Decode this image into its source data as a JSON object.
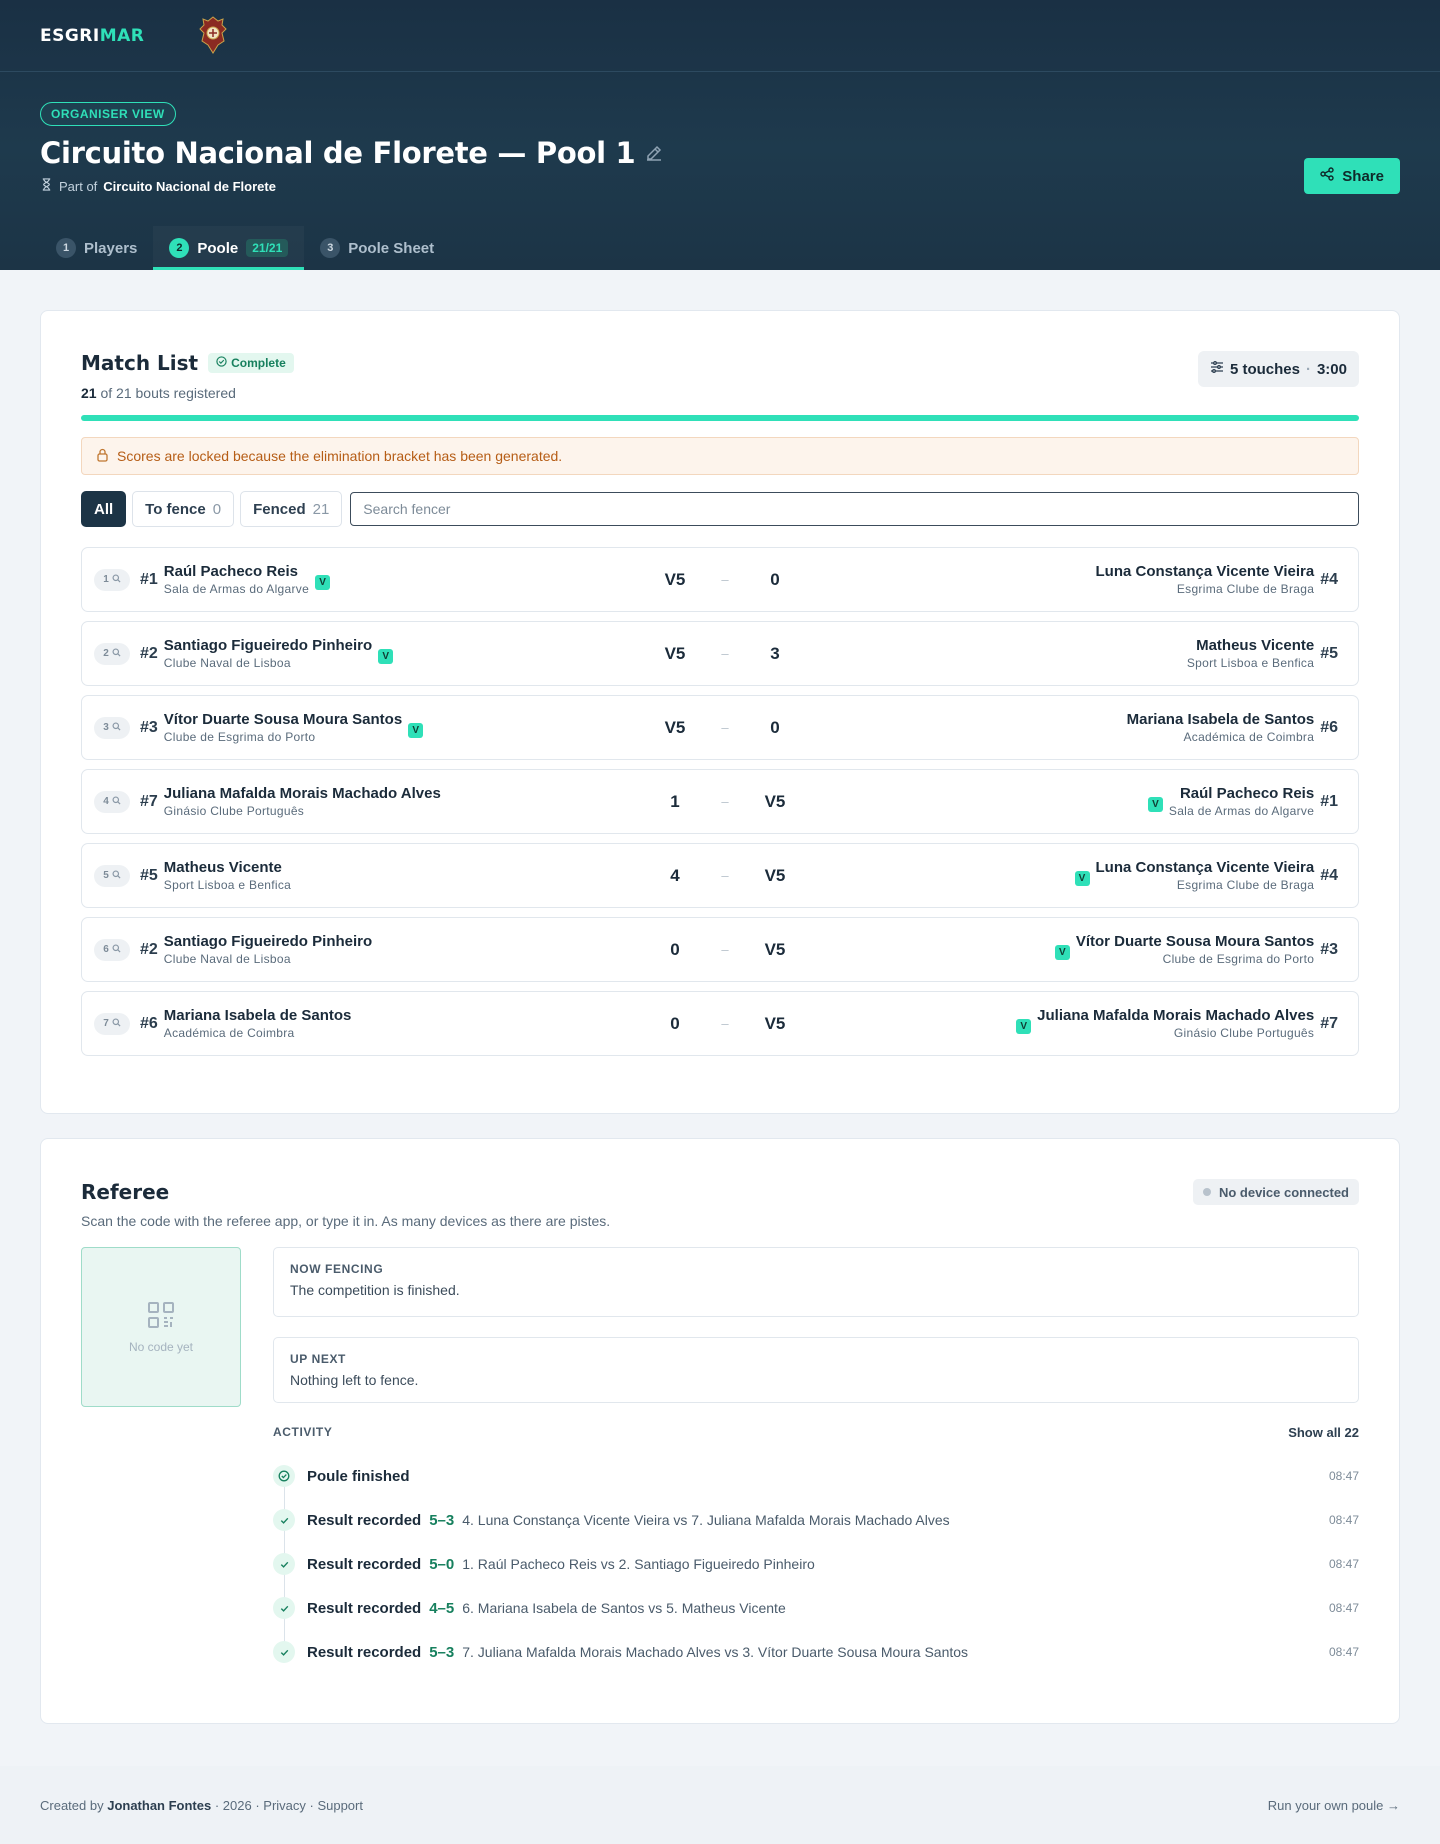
{
  "brand": {
    "logo_main": "ESGRI",
    "logo_accent": "MAR"
  },
  "header": {
    "badge": "ORGANISER VIEW",
    "title": "Circuito Nacional de Florete — Pool 1",
    "part_of_label": "Part of",
    "part_of_name": "Circuito Nacional de Florete",
    "share_label": "Share"
  },
  "tabs": [
    {
      "num": "1",
      "label": "Players"
    },
    {
      "num": "2",
      "label": "Poole",
      "count": "21/21"
    },
    {
      "num": "3",
      "label": "Poole Sheet"
    }
  ],
  "match_list": {
    "title": "Match List",
    "status": "Complete",
    "registered_count": "21",
    "registered_text": "of 21 bouts registered",
    "progress": 1.0,
    "touches": "5 touches",
    "time": "3:00",
    "locked_message": "Scores are locked because the elimination bracket has been generated.",
    "filters": {
      "all": "All",
      "to_fence": "To fence",
      "to_fence_count": "0",
      "fenced": "Fenced",
      "fenced_count": "21"
    },
    "search_placeholder": "Search fencer",
    "bouts": [
      {
        "n": "1",
        "left": {
          "seed": "#1",
          "name": "Raúl Pacheco Reis",
          "club": "Sala de Armas do Algarve",
          "winner": true
        },
        "left_score": "V5",
        "right_score": "0",
        "right": {
          "seed": "#4",
          "name": "Luna Constança Vicente Vieira",
          "club": "Esgrima Clube de Braga",
          "winner": false
        }
      },
      {
        "n": "2",
        "left": {
          "seed": "#2",
          "name": "Santiago Figueiredo Pinheiro",
          "club": "Clube Naval de Lisboa",
          "winner": true
        },
        "left_score": "V5",
        "right_score": "3",
        "right": {
          "seed": "#5",
          "name": "Matheus Vicente",
          "club": "Sport Lisboa e Benfica",
          "winner": false
        }
      },
      {
        "n": "3",
        "left": {
          "seed": "#3",
          "name": "Vítor Duarte Sousa Moura Santos",
          "club": "Clube de Esgrima do Porto",
          "winner": true
        },
        "left_score": "V5",
        "right_score": "0",
        "right": {
          "seed": "#6",
          "name": "Mariana Isabela de Santos",
          "club": "Académica de Coimbra",
          "winner": false
        }
      },
      {
        "n": "4",
        "left": {
          "seed": "#7",
          "name": "Juliana Mafalda Morais Machado Alves",
          "club": "Ginásio Clube Português",
          "winner": false
        },
        "left_score": "1",
        "right_score": "V5",
        "right": {
          "seed": "#1",
          "name": "Raúl Pacheco Reis",
          "club": "Sala de Armas do Algarve",
          "winner": true
        }
      },
      {
        "n": "5",
        "left": {
          "seed": "#5",
          "name": "Matheus Vicente",
          "club": "Sport Lisboa e Benfica",
          "winner": false
        },
        "left_score": "4",
        "right_score": "V5",
        "right": {
          "seed": "#4",
          "name": "Luna Constança Vicente Vieira",
          "club": "Esgrima Clube de Braga",
          "winner": true
        }
      },
      {
        "n": "6",
        "left": {
          "seed": "#2",
          "name": "Santiago Figueiredo Pinheiro",
          "club": "Clube Naval de Lisboa",
          "winner": false
        },
        "left_score": "0",
        "right_score": "V5",
        "right": {
          "seed": "#3",
          "name": "Vítor Duarte Sousa Moura Santos",
          "club": "Clube de Esgrima do Porto",
          "winner": true
        }
      },
      {
        "n": "7",
        "left": {
          "seed": "#6",
          "name": "Mariana Isabela de Santos",
          "club": "Académica de Coimbra",
          "winner": false
        },
        "left_score": "0",
        "right_score": "V5",
        "right": {
          "seed": "#7",
          "name": "Juliana Mafalda Morais Machado Alves",
          "club": "Ginásio Clube Português",
          "winner": true
        }
      }
    ],
    "winner_badge": "V"
  },
  "referee": {
    "title": "Referee",
    "device_status": "No device connected",
    "description": "Scan the code with the referee app, or type it in. As many devices as there are pistes.",
    "qr_placeholder": "No code yet",
    "now_fencing_label": "NOW FENCING",
    "now_fencing_text": "The competition is finished.",
    "up_next_label": "UP NEXT",
    "up_next_text": "Nothing left to fence.",
    "activity_label": "ACTIVITY",
    "show_all": "Show all 22",
    "activity": [
      {
        "title": "Poule finished",
        "score": "",
        "detail": "",
        "time": "08:47",
        "icon": "circle-check-icon"
      },
      {
        "title": "Result recorded",
        "score": "5–3",
        "detail": "4. Luna Constança Vicente Vieira vs 7. Juliana Mafalda Morais Machado Alves",
        "time": "08:47",
        "icon": "check-icon"
      },
      {
        "title": "Result recorded",
        "score": "5–0",
        "detail": "1. Raúl Pacheco Reis vs 2. Santiago Figueiredo Pinheiro",
        "time": "08:47",
        "icon": "check-icon"
      },
      {
        "title": "Result recorded",
        "score": "4–5",
        "detail": "6. Mariana Isabela de Santos vs 5. Matheus Vicente",
        "time": "08:47",
        "icon": "check-icon"
      },
      {
        "title": "Result recorded",
        "score": "5–3",
        "detail": "7. Juliana Mafalda Morais Machado Alves vs 3. Vítor Duarte Sousa Moura Santos",
        "time": "08:47",
        "icon": "check-icon"
      }
    ]
  },
  "footer": {
    "created_by": "Created by",
    "author": "Jonathan Fontes",
    "meta": "· 2026 · Privacy · Support",
    "cta": "Run your own poule →"
  },
  "colors": {
    "accent": "#2fe0b8",
    "header_bg": "#1c3446",
    "win_green": "#17805e",
    "warning": "#b65d16"
  }
}
